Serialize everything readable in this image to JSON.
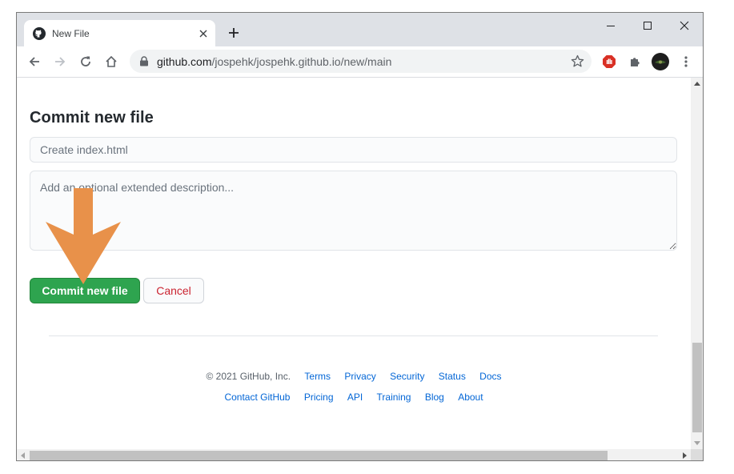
{
  "tab": {
    "title": "New File",
    "favicon": "github-icon"
  },
  "toolbar": {
    "url_host": "github.com",
    "url_path": "/jospehk/jospehk.github.io/new/main"
  },
  "commit": {
    "heading": "Commit new file",
    "summary_placeholder": "Create index.html",
    "description_placeholder": "Add an optional extended description...",
    "commit_label": "Commit new file",
    "cancel_label": "Cancel"
  },
  "footer": {
    "copyright": "© 2021 GitHub, Inc.",
    "row1_links": [
      "Terms",
      "Privacy",
      "Security",
      "Status",
      "Docs"
    ],
    "row2_links": [
      "Contact GitHub",
      "Pricing",
      "API",
      "Training",
      "Blog",
      "About"
    ]
  },
  "colors": {
    "commit_green": "#2ea44f",
    "cancel_red": "#cb2431",
    "link_blue": "#0366d6",
    "annotation_arrow": "#e8914a"
  },
  "annotation": {
    "icon": "down-arrow-icon"
  }
}
